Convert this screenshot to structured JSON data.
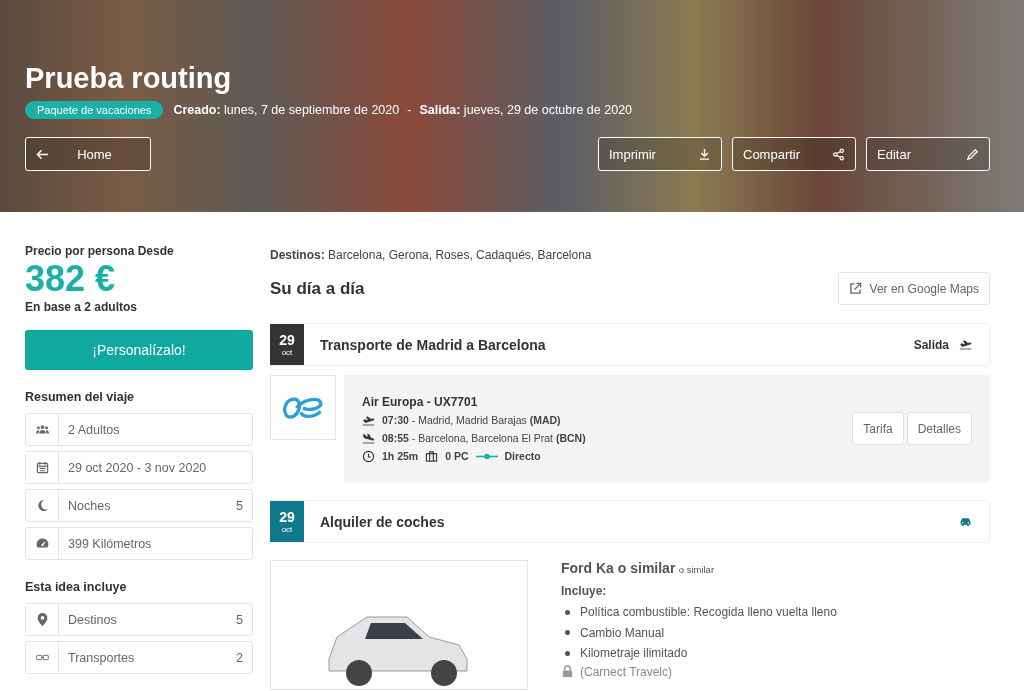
{
  "hero": {
    "title": "Prueba routing",
    "tag": "Paquete de vacaciones",
    "created_label": "Creado:",
    "created": "lunes, 7 de septiembre de 2020",
    "separator": "-",
    "departure_label": "Salida:",
    "departure": "jueves, 29 de octubre de 2020",
    "home_button": "Home",
    "actions": [
      {
        "label": "Imprimir",
        "kind": "download"
      },
      {
        "label": "Compartir",
        "kind": "share"
      },
      {
        "label": "Editar",
        "kind": "pencil"
      }
    ]
  },
  "summary": {
    "price_label": "Precio por persona Desde",
    "price": "382 €",
    "price_note": "En base a 2 adultos",
    "cta": "¡Personalízalo!",
    "trip_title": "Resumen del viaje",
    "trip_rows": [
      {
        "kind": "users",
        "label": "2 Adultos"
      },
      {
        "kind": "calendar",
        "label": "29 oct 2020 - 3 nov 2020"
      },
      {
        "kind": "moon",
        "label": "Noches",
        "value": "5"
      },
      {
        "kind": "gauge",
        "label": "399 Kilómetros"
      }
    ],
    "includes_title": "Esta idea incluye",
    "include_rows": [
      {
        "kind": "pin",
        "label": "Destinos",
        "value": "5"
      },
      {
        "kind": "transport",
        "label": "Transportes",
        "value": "2"
      }
    ]
  },
  "destinations_label": "Destinos:",
  "destinations": "Barcelona, Gerona, Roses, Cadaqués, Barcelona",
  "day_title": "Su día a día",
  "maps_button": "Ver en Google Maps",
  "days": [
    {
      "kind": "flight",
      "day": "29",
      "month": "oct",
      "color": "#333333",
      "title": "Transporte de Madrid a Barcelona",
      "end_label": "Salida",
      "airline": "Air Europa - UX7701",
      "legs": [
        {
          "kind": "takeoff",
          "text": "**07:30** - Madrid, Madrid Barajas **(MAD)**"
        },
        {
          "kind": "landing",
          "text": "**08:55** - Barcelona, Barcelona El Prat **(BCN)**"
        }
      ],
      "duration": "1h 25m",
      "baggage": "0 PC",
      "stops": "Directo",
      "buttons": [
        "Tarifa",
        "Detalles"
      ]
    },
    {
      "kind": "car",
      "day": "29",
      "month": "oct",
      "color": "#0e7a8c",
      "title": "Alquiler de coches",
      "name": "Ford Ka o similar",
      "name_note": "o similar",
      "includes_label": "Incluye:",
      "items": [
        "Política combustible: Recogida lleno vuelta lleno",
        "Cambio Manual",
        "Kilometraje ilimitado"
      ],
      "supplier": "(Carnect Travelc)"
    }
  ]
}
